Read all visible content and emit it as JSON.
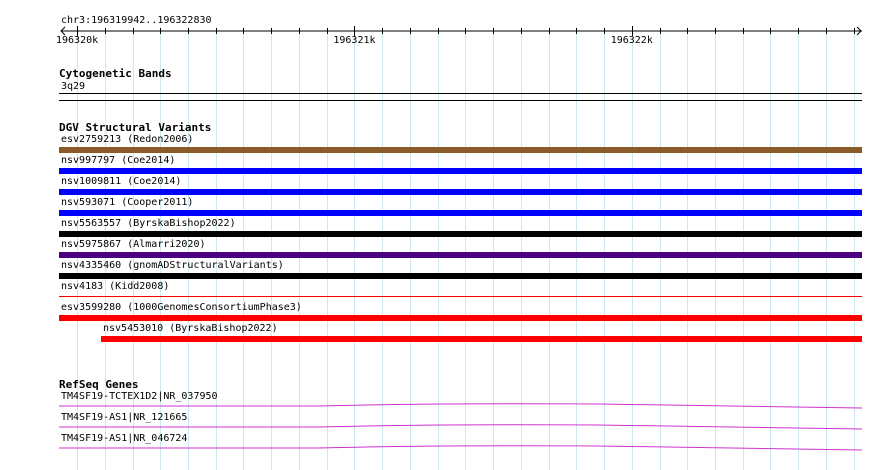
{
  "ruler": {
    "location": "chr3:196319942..196322830",
    "ticks": [
      {
        "label": "196320k",
        "pos": 196320000
      },
      {
        "label": "196321k",
        "pos": 196321000
      },
      {
        "label": "196322k",
        "pos": 196322000
      }
    ],
    "start": 196319942,
    "end": 196322830
  },
  "cytogenetic": {
    "title": "Cytogenetic Bands",
    "band": "3q29"
  },
  "dgv": {
    "title": "DGV Structural Variants",
    "variants": [
      {
        "label": "esv2759213 (Redon2006)",
        "color": "#8b5a2b"
      },
      {
        "label": "nsv997797 (Coe2014)",
        "color": "#0000ff"
      },
      {
        "label": "nsv1009811 (Coe2014)",
        "color": "#0000ff"
      },
      {
        "label": "nsv593071 (Cooper2011)",
        "color": "#0000ff"
      },
      {
        "label": "nsv5563557 (ByrskaBishop2022)",
        "color": "#000000"
      },
      {
        "label": "nsv5975867 (Almarri2020)",
        "color": "#4b0082"
      },
      {
        "label": "nsv4335460 (gnomADStructuralVariants)",
        "color": "#000000"
      },
      {
        "label": "nsv4183 (Kidd2008)",
        "color": "#ff0000"
      },
      {
        "label": "esv3599280 (1000GenomesConsortiumPhase3)",
        "color": "#ff0000"
      },
      {
        "label": "nsv5453010 (ByrskaBishop2022)",
        "color": "#ff0000"
      }
    ]
  },
  "refseq": {
    "title": "RefSeq Genes",
    "genes": [
      {
        "label": "TM4SF19-TCTEX1D2|NR_037950",
        "color": "#cc33cc"
      },
      {
        "label": "TM4SF19-AS1|NR_121665",
        "color": "#cc33cc"
      },
      {
        "label": "TM4SF19-AS1|NR_046724",
        "color": "#cc33cc"
      }
    ]
  },
  "colors": {
    "grid": "#cfe6ee",
    "ruler": "#000000"
  }
}
